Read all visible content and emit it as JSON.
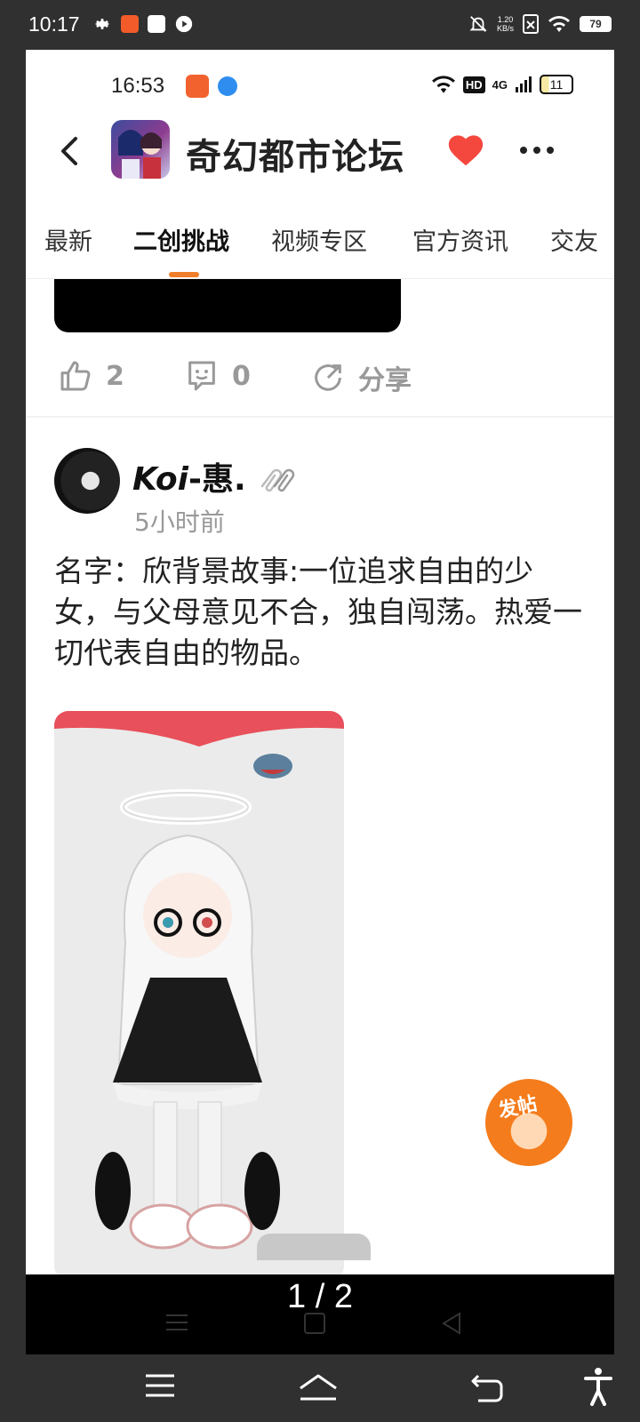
{
  "outer_status": {
    "time": "10:17",
    "net_speed_value": "1.20",
    "net_speed_unit": "KB/s",
    "battery": "79"
  },
  "inner_status": {
    "time": "16:53",
    "network": "4G",
    "hd": "HD",
    "battery": "11"
  },
  "header": {
    "title": "奇幻都市论坛"
  },
  "tabs": [
    "最新",
    "二创挑战",
    "视频专区",
    "官方资讯",
    "交友"
  ],
  "active_tab": 1,
  "actions": {
    "likes": "2",
    "comments": "0",
    "share": "分享"
  },
  "post": {
    "username_main": "Koi",
    "username_rest": "-惠.",
    "time": "5小时前",
    "text": "名字：欣背景故事:一位追求自由的少女，与父母意见不合，独自闯荡。热爱一切代表自由的物品。"
  },
  "fab": {
    "label": "发帖"
  },
  "viewer": {
    "page_indicator": "1 / 2"
  },
  "colors": {
    "accent": "#f07e2b",
    "heart": "#f4473e",
    "muted": "#999999"
  }
}
